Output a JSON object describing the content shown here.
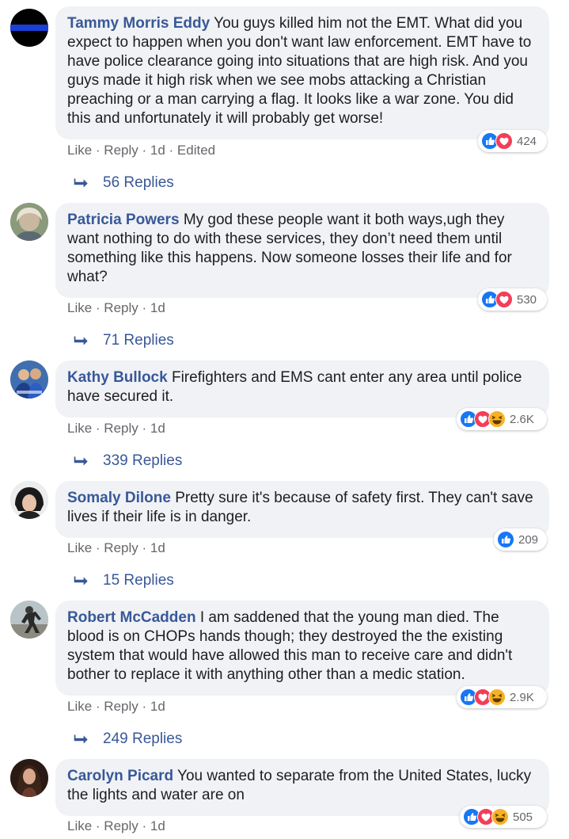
{
  "comments": [
    {
      "author": "Tammy Morris Eddy",
      "text": "You guys killed him not the EMT. What did you expect to happen when you don't want law enforcement. EMT have to have police clearance going into situations that are high risk. And you guys made it high risk when we see mobs attacking a Christian preaching or a man carrying a flag. It looks like a war zone. You did this and unfortunately it will probably get worse!",
      "like": "Like",
      "reply": "Reply",
      "time": "1d",
      "edited": "Edited",
      "reaction_count": "424",
      "reaction_icons": [
        "like-icon",
        "love-icon"
      ],
      "replies": "56 Replies"
    },
    {
      "author": "Patricia Powers",
      "text": "My god these people want it both ways,ugh they want nothing to do with these services, they don’t need them until something like this happens. Now someone losses their life and for what?",
      "like": "Like",
      "reply": "Reply",
      "time": "1d",
      "reaction_count": "530",
      "reaction_icons": [
        "like-icon",
        "love-icon"
      ],
      "replies": "71 Replies"
    },
    {
      "author": "Kathy Bullock",
      "text": "Firefighters and EMS cant enter any area until police have secured it.",
      "like": "Like",
      "reply": "Reply",
      "time": "1d",
      "reaction_count": "2.6K",
      "reaction_icons": [
        "like-icon",
        "love-icon",
        "haha-icon"
      ],
      "replies": "339 Replies"
    },
    {
      "author": "Somaly Dilone",
      "text": "Pretty sure it's because of safety first. They can't save lives if their life is in danger.",
      "like": "Like",
      "reply": "Reply",
      "time": "1d",
      "reaction_count": "209",
      "reaction_icons": [
        "like-icon"
      ],
      "replies": "15 Replies"
    },
    {
      "author": "Robert McCadden",
      "text": "I am saddened that the young man died. The blood is on CHOPs hands though; they destroyed the the existing system that would have allowed this man to receive care and didn't bother to replace it with anything other than a medic station.",
      "like": "Like",
      "reply": "Reply",
      "time": "1d",
      "reaction_count": "2.9K",
      "reaction_icons": [
        "like-icon",
        "love-icon",
        "haha-icon"
      ],
      "replies": "249 Replies"
    },
    {
      "author": "Carolyn Picard",
      "text": "You wanted to separate from the United States, lucky the lights and water are on",
      "like": "Like",
      "reply": "Reply",
      "time": "1d",
      "reaction_count": "505",
      "reaction_icons": [
        "like-icon",
        "love-icon",
        "haha-icon"
      ]
    }
  ],
  "separator": " · ",
  "colors": {
    "author": "#385898",
    "bubble": "#f0f2f5",
    "like_blue": "#1877f2",
    "love_red": "#f33e58",
    "haha_yellow": "#f7b125"
  }
}
